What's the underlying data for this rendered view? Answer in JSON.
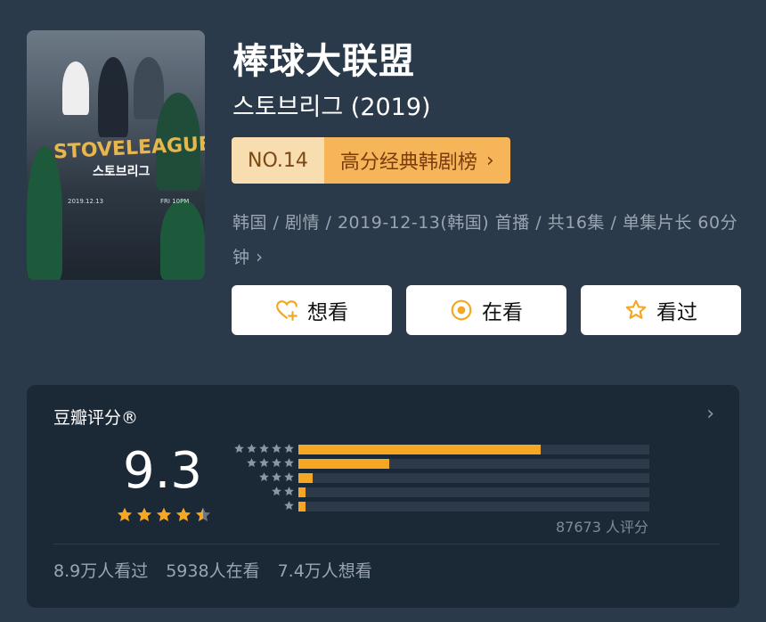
{
  "title": "棒球大联盟",
  "subtitle": "스토브리그 (2019)",
  "poster": {
    "logo_text": "STOVELEAGUE",
    "korean_text": "스토브리그",
    "date_text": "2019.12.13",
    "time_text": "FRI 10PM"
  },
  "rank": {
    "number": "NO.14",
    "list_name": "高分经典韩剧榜",
    "chevron": "›"
  },
  "meta": {
    "line": "韩国 / 剧情 / 2019-12-13(韩国) 首播 / 共16集 / 单集片长 60分钟",
    "more": "›"
  },
  "actions": [
    {
      "label": "想看",
      "icon": "heart-plus-icon"
    },
    {
      "label": "在看",
      "icon": "circle-dot-icon"
    },
    {
      "label": "看过",
      "icon": "star-outline-icon"
    }
  ],
  "rating": {
    "header": "豆瓣评分®",
    "arrow": "›",
    "score": "9.3",
    "star_value": 4.5,
    "distribution": [
      {
        "stars": 5,
        "percent": 69
      },
      {
        "stars": 4,
        "percent": 26
      },
      {
        "stars": 3,
        "percent": 4
      },
      {
        "stars": 2,
        "percent": 2
      },
      {
        "stars": 1,
        "percent": 2
      }
    ],
    "count_text": "87673 人评分",
    "footer": [
      "8.9万人看过",
      "5938人在看",
      "7.4万人想看"
    ]
  },
  "colors": {
    "background": "#2a3a4a",
    "card": "#1b2836",
    "accent": "#f5a623",
    "rank_light": "#f7ddb0",
    "rank_dark": "#f7b55a"
  }
}
